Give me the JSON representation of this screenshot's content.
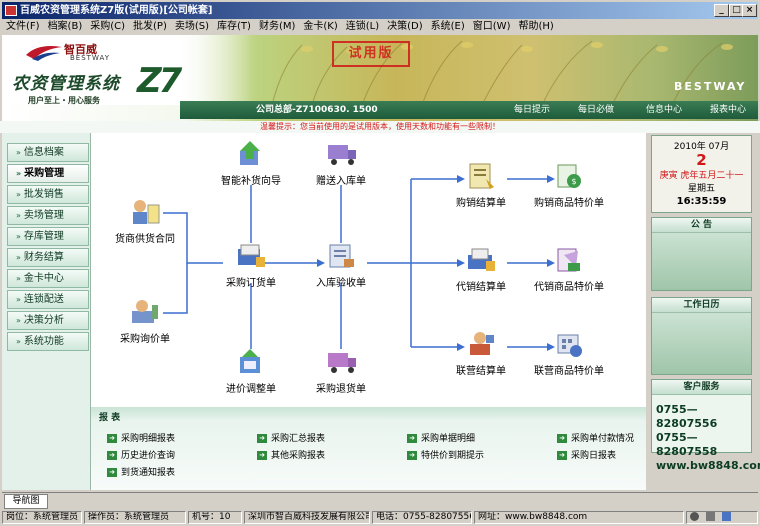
{
  "window": {
    "title": "百威农资管理系统Z7版(试用版)[公司帐套]",
    "controls": [
      "_",
      "□",
      "×"
    ]
  },
  "menu": [
    "文件(F)",
    "档案(B)",
    "采购(C)",
    "批发(P)",
    "卖场(S)",
    "库存(T)",
    "财务(M)",
    "金卡(K)",
    "连锁(L)",
    "决策(D)",
    "系统(E)",
    "窗口(W)",
    "帮助(H)"
  ],
  "header": {
    "brand_cn": "智百威",
    "brand_en": "BESTWAY",
    "system_name": "农资管理系统",
    "version_mark": "Z7",
    "slogan": "用户至上・用心服务",
    "stamp": "试用版",
    "bestway": "BESTWAY",
    "company": "公司总部-Z7100630. 1500",
    "nav": [
      "每日提示",
      "每日必做",
      "信息中心",
      "报表中心"
    ]
  },
  "tip": "温馨提示：您当前使用的是试用版本，使用天数和功能有一些限制！",
  "sidebar": {
    "items": [
      {
        "label": "信息档案",
        "active": false
      },
      {
        "label": "采购管理",
        "active": true
      },
      {
        "label": "批发销售",
        "active": false
      },
      {
        "label": "卖场管理",
        "active": false
      },
      {
        "label": "存库管理",
        "active": false
      },
      {
        "label": "财务结算",
        "active": false
      },
      {
        "label": "金卡中心",
        "active": false
      },
      {
        "label": "连锁配送",
        "active": false
      },
      {
        "label": "决策分析",
        "active": false
      },
      {
        "label": "系统功能",
        "active": false
      }
    ]
  },
  "flow": {
    "nodes": [
      {
        "id": "smart",
        "label": "智能补货向导",
        "icon": "replenish-icon"
      },
      {
        "id": "gift",
        "label": "赠送入库单",
        "icon": "truck-icon"
      },
      {
        "id": "contract",
        "label": "货商供货合同",
        "icon": "contract-icon"
      },
      {
        "id": "order",
        "label": "采购订货单",
        "icon": "order-icon"
      },
      {
        "id": "receive",
        "label": "入库验收单",
        "icon": "receive-icon"
      },
      {
        "id": "inquiry",
        "label": "采购询价单",
        "icon": "inquiry-icon"
      },
      {
        "id": "adjust",
        "label": "进价调整单",
        "icon": "adjust-icon"
      },
      {
        "id": "return",
        "label": "采购退货单",
        "icon": "return-truck-icon"
      },
      {
        "id": "buysell",
        "label": "购销结算单",
        "icon": "settle-icon"
      },
      {
        "id": "buysell_special",
        "label": "购销商品特价单",
        "icon": "special-price-icon"
      },
      {
        "id": "consign",
        "label": "代销结算单",
        "icon": "settle-icon"
      },
      {
        "id": "consign_special",
        "label": "代销商品特价单",
        "icon": "special-price-icon"
      },
      {
        "id": "joint",
        "label": "联营结算单",
        "icon": "settle-icon"
      },
      {
        "id": "joint_special",
        "label": "联营商品特价单",
        "icon": "special-price-icon"
      }
    ]
  },
  "report": {
    "title": "报 表",
    "items": [
      "采购明细报表",
      "采购汇总报表",
      "采购单据明细",
      "采购单付款情况",
      "历史进价查询",
      "其他采购报表",
      "特供价到期提示",
      "采购日报表",
      "到货通知报表"
    ]
  },
  "calendar": {
    "year_month": "2010年 07月",
    "day": "2",
    "lunar": "庚寅 虎年五月二十一",
    "weekday": "星期五",
    "time": "16:35:59"
  },
  "panels": {
    "notice": "公 告",
    "workcal": "工作日历",
    "service": "客户服务",
    "phones": [
      "0755—82807556",
      "0755—82807558"
    ],
    "website": "www.bw8848.com"
  },
  "bottom": {
    "tab": "导航图"
  },
  "status": {
    "post": "岗位：系统管理员",
    "operator": "操作员：系统管理员",
    "machine": "机号：10",
    "company": "深圳市智百威科技发展有限公司",
    "phone": "电话：0755-82807556",
    "url": "网址：www.bw8848.com"
  },
  "colors": {
    "title_bar": "#0a246a",
    "accent_green": "#1e5b3c",
    "tip_red": "#d01818",
    "flow_line": "#3b6fd0"
  }
}
